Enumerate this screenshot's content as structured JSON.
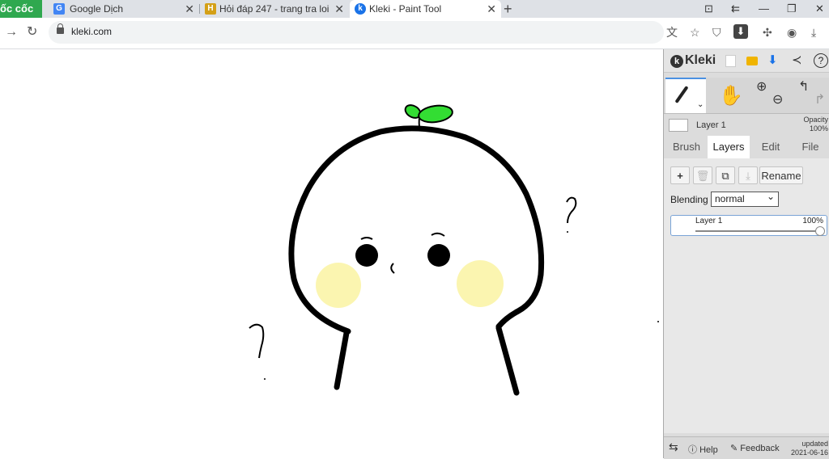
{
  "browser": {
    "brand_label": "ốc cốc",
    "tabs": [
      {
        "title": "Google Dịch",
        "favicon": "google-translate-icon",
        "favicon_color": "#4285f4"
      },
      {
        "title": "Hỏi đáp 247 - trang tra loi",
        "favicon": "hoidap-icon",
        "favicon_color": "#d4a017"
      },
      {
        "title": "Kleki - Paint Tool",
        "favicon": "kleki-icon",
        "favicon_color": "#1a73e8"
      }
    ],
    "url": "kleki.com"
  },
  "kleki": {
    "logo_text": "Kleki",
    "layer_info_name": "Layer 1",
    "opacity_label": "Opacity",
    "opacity_value": "100%",
    "tabs": [
      "Brush",
      "Layers",
      "Edit",
      "File"
    ],
    "active_tab": "Layers",
    "rename_label": "Rename",
    "blending_label": "Blending",
    "blending_value": "normal",
    "layer_item": {
      "name": "Layer 1",
      "opacity": "100%",
      "opacity_fraction": 1.0
    },
    "footer": {
      "help_label": "Help",
      "feedback_label": "Feedback",
      "updated_label": "updated",
      "updated_date": "2021-06-16"
    }
  },
  "colors": {
    "sprout": "#33dd33",
    "cheek": "#fbf5b0",
    "accent": "#1a73e8"
  }
}
